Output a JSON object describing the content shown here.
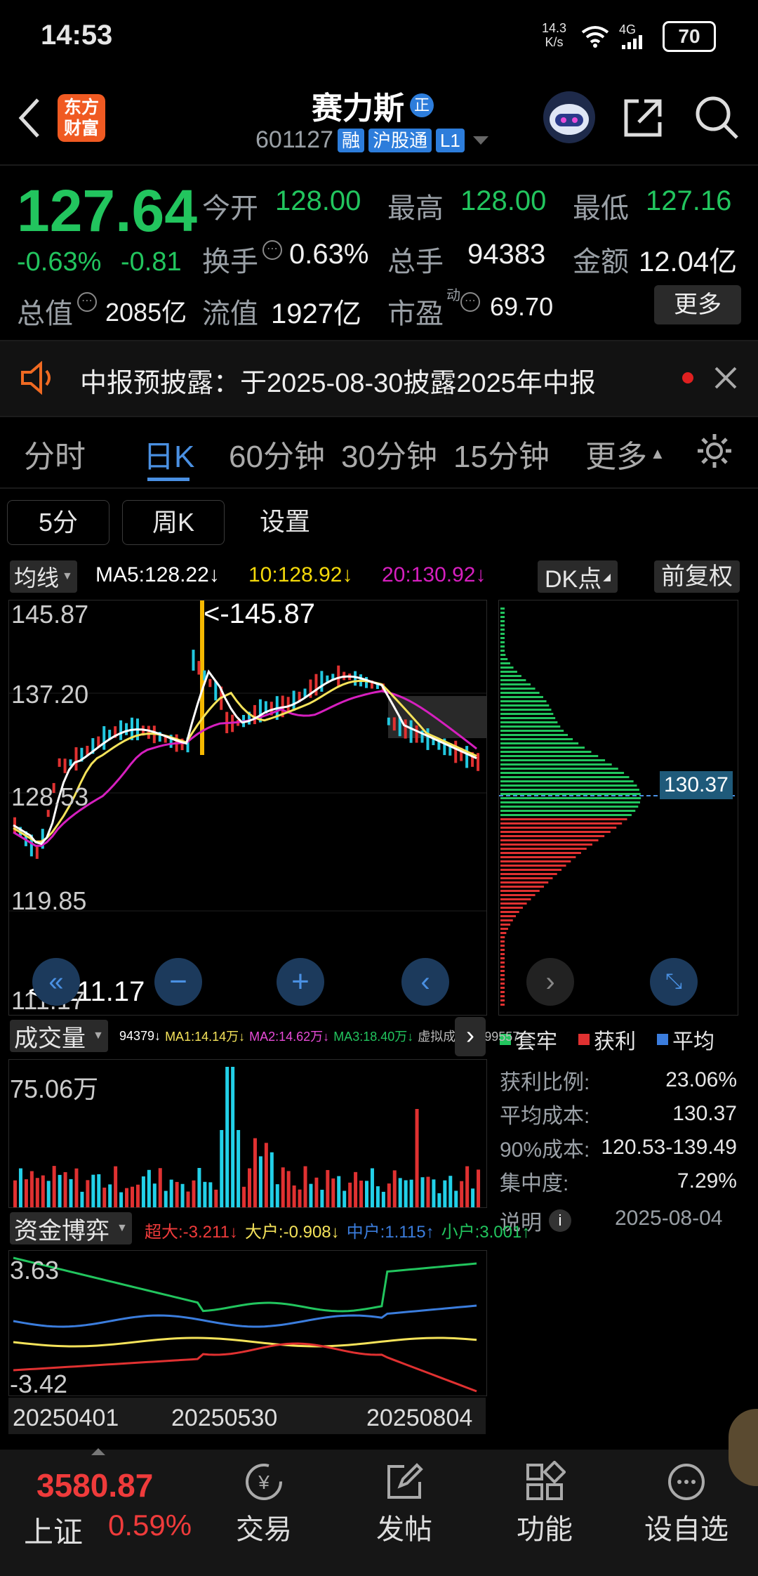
{
  "status": {
    "time": "14:53",
    "net_speed": "14.3",
    "net_unit": "K/s",
    "net_type": "4G",
    "battery": "70"
  },
  "header": {
    "logo_line1": "东方",
    "logo_line2": "财富",
    "name": "赛力斯",
    "name_badge": "正",
    "code": "601127",
    "tag1": "融",
    "tag2": "沪股通",
    "tag3": "L1"
  },
  "quote": {
    "price": "127.64",
    "pct": "-0.63%",
    "chg": "-0.81",
    "open_label": "今开",
    "open": "128.00",
    "high_label": "最高",
    "high": "128.00",
    "low_label": "最低",
    "low": "127.16",
    "turnover_label": "换手",
    "turnover": "0.63%",
    "vol_label": "总手",
    "vol": "94383",
    "amount_label": "金额",
    "amount": "12.04亿",
    "mcap_label": "总值",
    "mcap": "2085亿",
    "float_label": "流值",
    "float": "1927亿",
    "pe_label": "市盈",
    "pe_sup": "动",
    "pe": "69.70",
    "more": "更多"
  },
  "notice": {
    "text": "中报预披露：于2025-08-30披露2025年中报"
  },
  "tabs": [
    {
      "label": "分时"
    },
    {
      "label": "日K"
    },
    {
      "label": "60分钟"
    },
    {
      "label": "30分钟"
    },
    {
      "label": "15分钟"
    },
    {
      "label": "更多"
    }
  ],
  "subtabs": {
    "a": "5分",
    "b": "周K",
    "c": "设置"
  },
  "ma": {
    "selector": "均线",
    "ma5": "MA5:128.22↓",
    "ma10": "10:128.92↓",
    "ma20": "20:130.92↓",
    "dk": "DK点",
    "fq": "前复权"
  },
  "kchart": {
    "y_top": "145.87",
    "y2": "137.20",
    "y3": "128.53",
    "y4": "119.85",
    "y_bot": "111.17",
    "max_label": "<-145.87",
    "min_label": "<--111.17"
  },
  "chip": {
    "price_label": "130.37",
    "legend1": "套牢",
    "legend2": "获利",
    "legend3": "平均",
    "rows": [
      {
        "k": "获利比例:",
        "v": "23.06%"
      },
      {
        "k": "平均成本:",
        "v": "130.37"
      },
      {
        "k": "90%成本:",
        "v": "120.53-139.49"
      },
      {
        "k": "集中度:",
        "v": "7.29%"
      }
    ],
    "note": "说明",
    "date": "2025-08-04"
  },
  "volume": {
    "selector": "成交量",
    "vol": "94379↓",
    "ma1": "MA1:14.14万↓",
    "ma2": "MA2:14.62万↓",
    "ma3": "MA3:18.40万↓",
    "virtual": "虚拟成交量:99557",
    "y_top": "75.06万"
  },
  "fund": {
    "selector": "资金博弈",
    "super": "超大:-3.211↓",
    "big": "大户:-0.908↓",
    "mid": "中户:1.115↑",
    "small": "小户:3.001↑",
    "y_top": "3.63",
    "y_bot": "-3.42"
  },
  "dates": [
    "20250401",
    "20250530",
    "20250804"
  ],
  "bottom": {
    "index_value": "3580.87",
    "index_name": "上证",
    "index_pct": "0.59%",
    "trade": "交易",
    "post": "发帖",
    "func": "功能",
    "watch": "设自选"
  }
}
